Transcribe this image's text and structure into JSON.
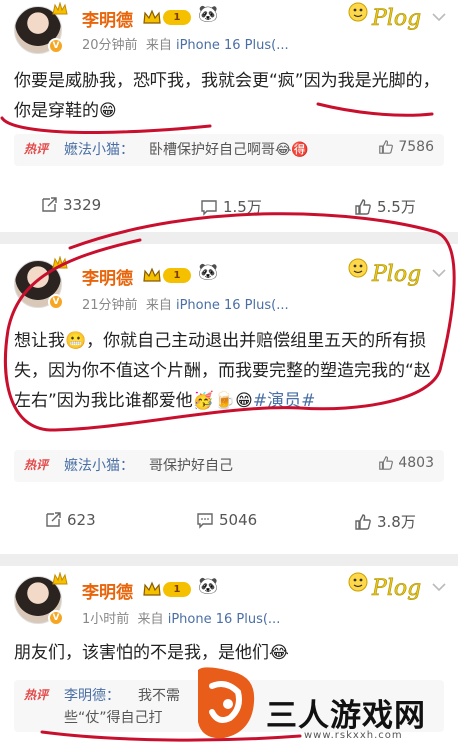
{
  "posts": [
    {
      "username": "李明德",
      "level": "1",
      "time": "20分钟前",
      "source_prefix": "来自",
      "device": "iPhone 16 Plus(...",
      "content": "你要是威胁我，恐吓我，我就会更“疯”因为我是光脚的，你是穿鞋的😁",
      "hot_label": "热评",
      "comment_user": "嬷法小猫：",
      "comment_text": "卧槽保护好自己啊哥😂🉐",
      "comment_likes": "7586",
      "reposts": "3329",
      "comments": "1.5万",
      "likes": "5.5万"
    },
    {
      "username": "李明德",
      "level": "1",
      "time": "21分钟前",
      "source_prefix": "来自",
      "device": "iPhone 16 Plus(...",
      "content_a": "想让我😬，你就自己主动退出并赔偿组里五天的所有损失，因为你不值这个片酬，而我要完整的塑造完我的“赵左右”因为我比谁都爱他🥳🍺😁",
      "content_tag": "#演员#",
      "hot_label": "热评",
      "comment_user": "嬷法小猫：",
      "comment_text": "哥保护好自己",
      "comment_likes": "4803",
      "reposts": "623",
      "comments": "5046",
      "likes": "3.8万"
    },
    {
      "username": "李明德",
      "level": "1",
      "time": "1小时前",
      "source_prefix": "来自",
      "device": "iPhone 16 Plus(...",
      "content": "朋友们，该害怕的不是我，是他们😂",
      "hot_label": "热评",
      "comment_user": "李明德：",
      "comment_text": "我不需",
      "comment_text_line2": "些“仗”得自己打"
    }
  ],
  "plog_badge": "Plog",
  "watermark": {
    "title": "三人游戏网",
    "url": "www.rskxxh.com"
  },
  "colors": {
    "username": "#e8650c",
    "link": "#4a6fa5",
    "hot": "#e34a4a",
    "scribble": "#c8102e",
    "watermark_accent": "#e85d1a"
  }
}
